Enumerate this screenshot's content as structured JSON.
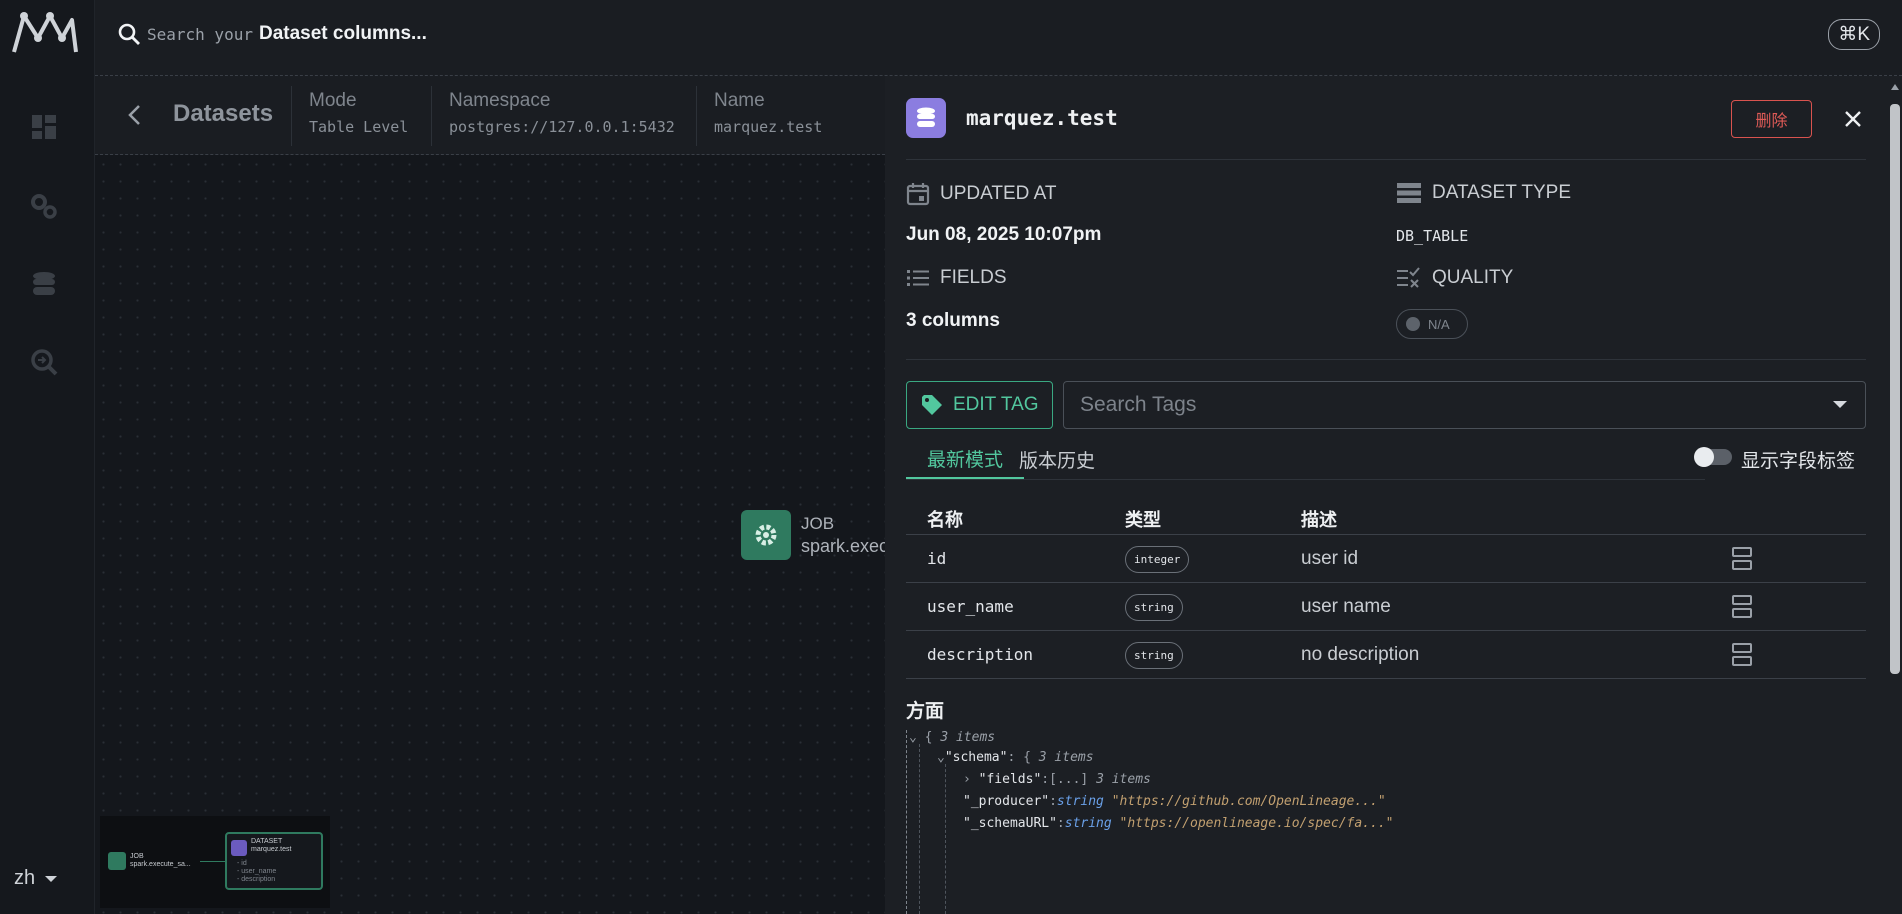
{
  "search": {
    "prefix": "Search your",
    "strong": "Dataset columns...",
    "shortcut": "⌘K"
  },
  "rail": {
    "language": "zh"
  },
  "breadcrumb": {
    "title": "Datasets",
    "items": [
      {
        "label": "Mode",
        "value": "Table Level"
      },
      {
        "label": "Namespace",
        "value": "postgres://127.0.0.1:5432"
      },
      {
        "label": "Name",
        "value": "marquez.test"
      }
    ]
  },
  "canvas": {
    "job_node": {
      "kind": "JOB",
      "name": "spark.exec"
    },
    "minimap": {
      "job": {
        "kind": "JOB",
        "name": "spark.execute_sa..."
      },
      "dataset": {
        "kind": "DATASET",
        "name": "marquez.test",
        "fields": [
          "- id",
          "- user_name",
          "- description"
        ]
      }
    }
  },
  "drawer": {
    "dataset_name": "marquez.test",
    "delete_label": "删除",
    "updated_at": {
      "label": "UPDATED AT",
      "value": "Jun 08, 2025 10:07pm"
    },
    "dataset_type": {
      "label": "DATASET TYPE",
      "value": "DB_TABLE"
    },
    "fields": {
      "label": "FIELDS",
      "value": "3 columns"
    },
    "quality": {
      "label": "QUALITY",
      "value": "N/A"
    },
    "edit_tag_label": "EDIT TAG",
    "search_tags_placeholder": "Search Tags",
    "tabs": [
      {
        "label": "最新模式"
      },
      {
        "label": "版本历史"
      }
    ],
    "toggle_label": "显示字段标签",
    "columns": {
      "name": "名称",
      "type": "类型",
      "desc": "描述"
    },
    "rows": [
      {
        "name": "id",
        "type": "integer",
        "desc": "user id"
      },
      {
        "name": "user_name",
        "type": "string",
        "desc": "user name"
      },
      {
        "name": "description",
        "type": "string",
        "desc": "no description"
      }
    ],
    "facets_title": "方面",
    "json": {
      "root_count": "3 items",
      "schema_key": "\"schema\"",
      "schema_count": "3 items",
      "fields_key": "\"fields\"",
      "fields_collapsed": "[...]",
      "fields_count": "3 items",
      "producer_key": "\"_producer\"",
      "producer_type": "string",
      "producer_val": "\"https://github.com/OpenLineage...\"",
      "schemaurl_key": "\"_schemaURL\"",
      "schemaurl_type": "string",
      "schemaurl_val": "\"https://openlineage.io/spec/fa...\""
    }
  },
  "colors": {
    "accent": "#52c79e",
    "danger": "#e05b57",
    "dataset": "#8b7de0",
    "job": "#2f7a5f"
  }
}
